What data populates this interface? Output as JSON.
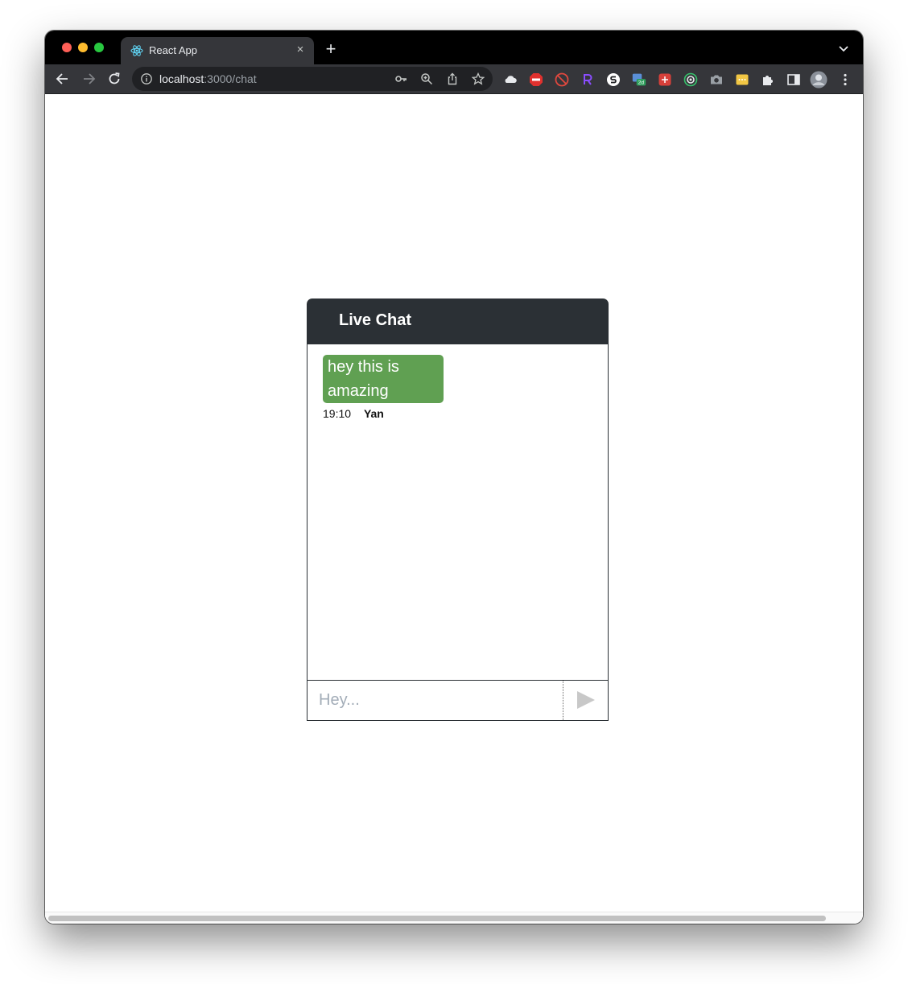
{
  "browser": {
    "tab": {
      "title": "React App",
      "close_glyph": "×"
    },
    "new_tab_glyph": "+",
    "address_bar": {
      "host": "localhost",
      "path": ":3000/chat"
    }
  },
  "chat": {
    "title": "Live Chat",
    "messages": [
      {
        "text": "hey this is amazing",
        "time": "19:10",
        "author": "Yan"
      }
    ],
    "input": {
      "placeholder": "Hey...",
      "value": ""
    }
  },
  "colors": {
    "header_bg": "#2b3035",
    "bubble_bg": "#60a052",
    "browser_frame": "#35363a"
  },
  "icons": {
    "favicon": "react-logo-icon",
    "send": "send-triangle-icon"
  }
}
